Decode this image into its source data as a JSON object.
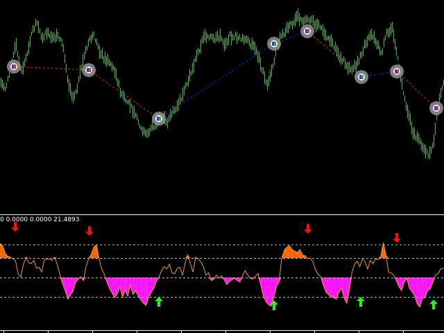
{
  "terminal": {
    "indicator_readout": "0 0.0000 0.0000 21.4893"
  },
  "colors": {
    "background": "#000000",
    "price_bars": "#32c832",
    "signal_line_down": "#ff2020",
    "signal_line_up": "#1a2aff",
    "signal_marker_ring": "#8c8c8c",
    "oscillator_line": "#f0a020",
    "fill_positive": "#ff6a00",
    "fill_negative": "#ff1aff",
    "level_lines": "#bfbfbf",
    "arrow_sell": "#ff1010",
    "arrow_buy": "#18ff18",
    "separator": "#ffffff"
  },
  "chart_data": [
    {
      "type": "line",
      "panel": "price",
      "series": [
        {
          "values": [
            0.55,
            0.5,
            0.65,
            0.8,
            0.6,
            0.72,
            0.88,
            0.95,
            0.85,
            0.88,
            0.83,
            0.87,
            0.8,
            0.55,
            0.43,
            0.55,
            0.72,
            0.82,
            0.86,
            0.76,
            0.7,
            0.68,
            0.62,
            0.48,
            0.42,
            0.38,
            0.32,
            0.22,
            0.18,
            0.24,
            0.26,
            0.3,
            0.28,
            0.34,
            0.38,
            0.46,
            0.56,
            0.66,
            0.76,
            0.86,
            0.86,
            0.83,
            0.86,
            0.8,
            0.86,
            0.86,
            0.84,
            0.83,
            0.8,
            0.76,
            0.65,
            0.52,
            0.62,
            0.8,
            0.86,
            0.91,
            0.95,
            0.99,
            0.94,
            0.98,
            0.95,
            0.93,
            0.89,
            0.84,
            0.78,
            0.72,
            0.68,
            0.62,
            0.65,
            0.72,
            0.82,
            0.88,
            0.82,
            0.74,
            0.88,
            0.92,
            0.72,
            0.5,
            0.35,
            0.2,
            0.15,
            0.1,
            0.05,
            0.14,
            0.42,
            0.58
          ]
        }
      ]
    },
    {
      "type": "area",
      "panel": "oscillator",
      "ylim": [
        -100,
        100
      ],
      "levels": [
        85,
        50,
        0,
        -50
      ],
      "series": [
        {
          "values": [
            88,
            82,
            62,
            55,
            52,
            48,
            42,
            8,
            2,
            34,
            52,
            38,
            36,
            44,
            24,
            26,
            14,
            46,
            48,
            47,
            44,
            52,
            32,
            6,
            -16,
            -34,
            -56,
            -45,
            -36,
            -12,
            -5,
            2,
            -8,
            28,
            48,
            60,
            78,
            84,
            48,
            22,
            8,
            -12,
            -28,
            -40,
            -52,
            -42,
            -24,
            -52,
            -32,
            -48,
            -20,
            -44,
            -34,
            -48,
            -58,
            -66,
            -72,
            -52,
            -38,
            -28,
            -10,
            2,
            18,
            28,
            22,
            34,
            12,
            10,
            24,
            26,
            6,
            38,
            58,
            36,
            14,
            52,
            48,
            40,
            28,
            6,
            12,
            -8,
            -4,
            6,
            -2,
            4,
            -6,
            -18,
            -10,
            -6,
            -2,
            -8,
            -12,
            4,
            18,
            6,
            -2,
            -4,
            4,
            10,
            -20,
            -48,
            -62,
            -70,
            -74,
            -52,
            -24,
            -12,
            48,
            70,
            78,
            82,
            72,
            68,
            64,
            72,
            58,
            56,
            48,
            50,
            40,
            20,
            8,
            2,
            -20,
            -38,
            -44,
            -50,
            -52,
            -56,
            -38,
            -28,
            -54,
            -66,
            -30,
            14,
            34,
            42,
            28,
            48,
            40,
            22,
            44,
            36,
            48,
            46,
            54,
            90,
            58,
            14,
            12,
            6,
            -8,
            -24,
            -34,
            -12,
            -2,
            -28,
            -36,
            -48,
            -68,
            -76,
            -54,
            -52,
            -34,
            -30,
            -12,
            6,
            10,
            22,
            24
          ]
        }
      ]
    }
  ]
}
